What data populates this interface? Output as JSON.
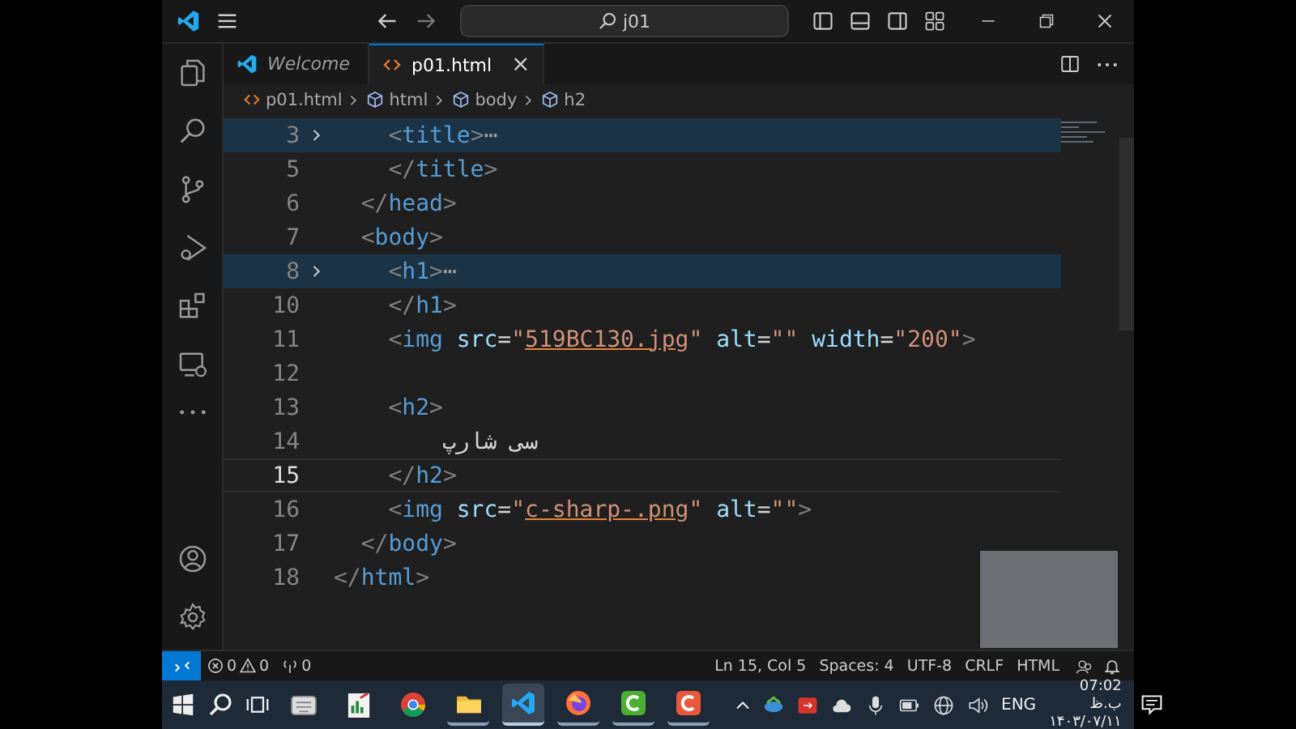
{
  "title_bar": {
    "search": "j01"
  },
  "tabs": [
    {
      "label": "Welcome",
      "kind": "welcome",
      "preview": true,
      "selected": false
    },
    {
      "label": "p01.html",
      "kind": "html",
      "preview": false,
      "selected": true,
      "close": "×"
    }
  ],
  "breadcrumbs": [
    {
      "label": "p01.html",
      "kind": "file"
    },
    {
      "label": "html",
      "kind": "element"
    },
    {
      "label": "body",
      "kind": "element"
    },
    {
      "label": "h2",
      "kind": "element"
    }
  ],
  "editor": {
    "lines": [
      {
        "number": "3",
        "folded": true,
        "current": false,
        "tokens": [
          {
            "kind": "p",
            "text": "    <"
          },
          {
            "kind": "tag",
            "text": "title"
          },
          {
            "kind": "p",
            "text": ">"
          },
          {
            "kind": "fold",
            "text": "⋯"
          }
        ]
      },
      {
        "number": "5",
        "folded": false,
        "current": false,
        "tokens": [
          {
            "kind": "p",
            "text": "    </"
          },
          {
            "kind": "tag",
            "text": "title"
          },
          {
            "kind": "p",
            "text": ">"
          }
        ]
      },
      {
        "number": "6",
        "folded": false,
        "current": false,
        "tokens": [
          {
            "kind": "p",
            "text": "  </"
          },
          {
            "kind": "tag",
            "text": "head"
          },
          {
            "kind": "p",
            "text": ">"
          }
        ]
      },
      {
        "number": "7",
        "folded": false,
        "current": false,
        "tokens": [
          {
            "kind": "p",
            "text": "  <"
          },
          {
            "kind": "tag",
            "text": "body"
          },
          {
            "kind": "p",
            "text": ">"
          }
        ]
      },
      {
        "number": "8",
        "folded": true,
        "current": false,
        "tokens": [
          {
            "kind": "p",
            "text": "    <"
          },
          {
            "kind": "tag",
            "text": "h1"
          },
          {
            "kind": "p",
            "text": ">"
          },
          {
            "kind": "fold",
            "text": "⋯"
          }
        ]
      },
      {
        "number": "10",
        "folded": false,
        "current": false,
        "tokens": [
          {
            "kind": "p",
            "text": "    </"
          },
          {
            "kind": "tag",
            "text": "h1"
          },
          {
            "kind": "p",
            "text": ">"
          }
        ]
      },
      {
        "number": "11",
        "folded": false,
        "current": false,
        "tokens": [
          {
            "kind": "p",
            "text": "    <"
          },
          {
            "kind": "tag",
            "text": "img"
          },
          {
            "kind": "attr",
            "text": " src"
          },
          {
            "kind": "eq",
            "text": "="
          },
          {
            "kind": "str",
            "text": "\""
          },
          {
            "kind": "link",
            "text": "519BC130.jpg"
          },
          {
            "kind": "str",
            "text": "\""
          },
          {
            "kind": "attr",
            "text": " alt"
          },
          {
            "kind": "eq",
            "text": "="
          },
          {
            "kind": "str",
            "text": "\"\""
          },
          {
            "kind": "attr",
            "text": " width"
          },
          {
            "kind": "eq",
            "text": "="
          },
          {
            "kind": "str",
            "text": "\"200\""
          },
          {
            "kind": "p",
            "text": ">"
          }
        ]
      },
      {
        "number": "12",
        "folded": false,
        "current": false
      },
      {
        "number": "13",
        "folded": false,
        "current": false,
        "tokens": [
          {
            "kind": "p",
            "text": "    <"
          },
          {
            "kind": "tag",
            "text": "h2"
          },
          {
            "kind": "p",
            "text": ">"
          }
        ]
      },
      {
        "number": "14",
        "folded": false,
        "current": false,
        "tokens": [
          {
            "kind": "rtl",
            "text": "سی شارپ"
          }
        ]
      },
      {
        "number": "15",
        "folded": false,
        "current": true,
        "tokens": [
          {
            "kind": "p",
            "text": "    </"
          },
          {
            "kind": "tag",
            "text": "h2"
          },
          {
            "kind": "p",
            "text": ">"
          }
        ]
      },
      {
        "number": "16",
        "folded": false,
        "current": false,
        "tokens": [
          {
            "kind": "p",
            "text": "    <"
          },
          {
            "kind": "tag",
            "text": "img"
          },
          {
            "kind": "attr",
            "text": " src"
          },
          {
            "kind": "eq",
            "text": "="
          },
          {
            "kind": "str",
            "text": "\""
          },
          {
            "kind": "link",
            "text": "c-sharp-.png"
          },
          {
            "kind": "str",
            "text": "\""
          },
          {
            "kind": "attr",
            "text": " alt"
          },
          {
            "kind": "eq",
            "text": "="
          },
          {
            "kind": "str",
            "text": "\"\""
          },
          {
            "kind": "p",
            "text": ">"
          }
        ]
      },
      {
        "number": "17",
        "folded": false,
        "current": false,
        "tokens": [
          {
            "kind": "p",
            "text": "  </"
          },
          {
            "kind": "tag",
            "text": "body"
          },
          {
            "kind": "p",
            "text": ">"
          }
        ]
      },
      {
        "number": "18",
        "folded": false,
        "current": false,
        "tokens": [
          {
            "kind": "p",
            "text": "</"
          },
          {
            "kind": "tag",
            "text": "html"
          },
          {
            "kind": "p",
            "text": ">"
          }
        ]
      }
    ]
  },
  "status_bar": {
    "errors": "0",
    "warnings": "0",
    "ports": "0",
    "items": [
      "Ln 15, Col 5",
      "Spaces: 4",
      "UTF-8",
      "CRLF",
      "HTML"
    ]
  },
  "taskbar": {
    "apps": [
      {
        "kind": "keyboard",
        "running": false,
        "selected": false
      },
      {
        "kind": "chart-doc",
        "running": false,
        "selected": false
      },
      {
        "kind": "round-browser",
        "running": false,
        "selected": false
      },
      {
        "kind": "folder",
        "running": true,
        "selected": false
      },
      {
        "kind": "code",
        "running": true,
        "selected": true
      },
      {
        "kind": "fox-browser",
        "running": true,
        "selected": false
      },
      {
        "kind": "c-green",
        "running": true,
        "selected": false
      },
      {
        "kind": "c-orange",
        "running": true,
        "selected": false
      }
    ],
    "language": "ENG",
    "time": "07:02 ب.ظ",
    "date": "۱۴۰۳/۰۷/۱۱"
  }
}
